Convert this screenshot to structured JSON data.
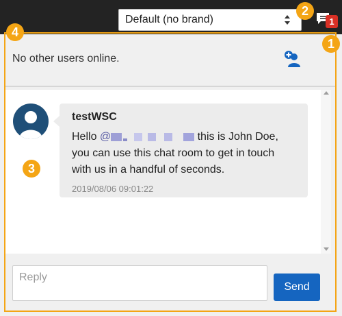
{
  "colors": {
    "topbar": "#232323",
    "panel": "#f0f0f0",
    "accent_marker": "#f4a515",
    "badge": "#d93025",
    "primary_button": "#1565c0",
    "mention": "#5b5ea6"
  },
  "header": {
    "brand_select": {
      "selected": "Default (no brand)"
    },
    "chat_toggle": {
      "icon": "chat-bubbles-icon",
      "count": "1"
    }
  },
  "markers": {
    "one": "1",
    "two": "2",
    "three": "3",
    "four": "4"
  },
  "chat": {
    "status_text": "No other users online.",
    "invite_icon": "add-user-icon",
    "messages": [
      {
        "sender": "testWSC",
        "avatar_icon": "user-avatar-icon",
        "mention_prefix": "@",
        "text": " this is John Doe, you can use this chat room to get in touch with us in a handful of seconds.",
        "timestamp": "2019/08/06 09:01:22"
      }
    ],
    "reply": {
      "placeholder": "Reply"
    },
    "send_label": "Send"
  }
}
